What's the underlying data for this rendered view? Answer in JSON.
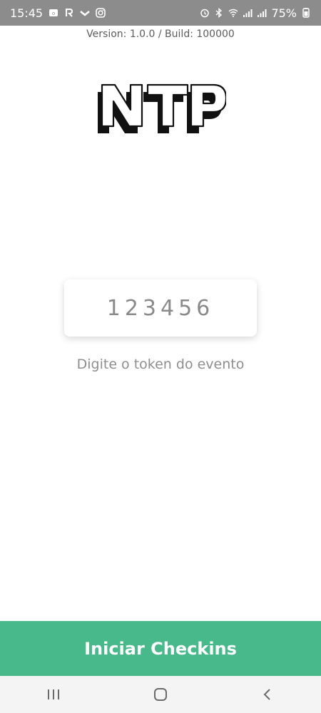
{
  "status": {
    "time": "15:45",
    "battery": "75%",
    "icons_left": [
      "notification-icon",
      "r-app-icon",
      "chevron-icon",
      "instagram-icon"
    ],
    "icons_right": [
      "alarm-icon",
      "bluetooth-icon",
      "wifi-icon",
      "signal-icon",
      "signal-icon",
      "battery-icon"
    ]
  },
  "version": "Version: 1.0.0 / Build: 100000",
  "logo": {
    "text": "NTP"
  },
  "token": {
    "placeholder": "123456"
  },
  "helper": "Digite o token do evento",
  "cta": {
    "label": "Iniciar Checkins",
    "color": "#48b98a"
  },
  "nav": {
    "icons": [
      "recent-apps-icon",
      "home-icon",
      "back-icon"
    ]
  }
}
